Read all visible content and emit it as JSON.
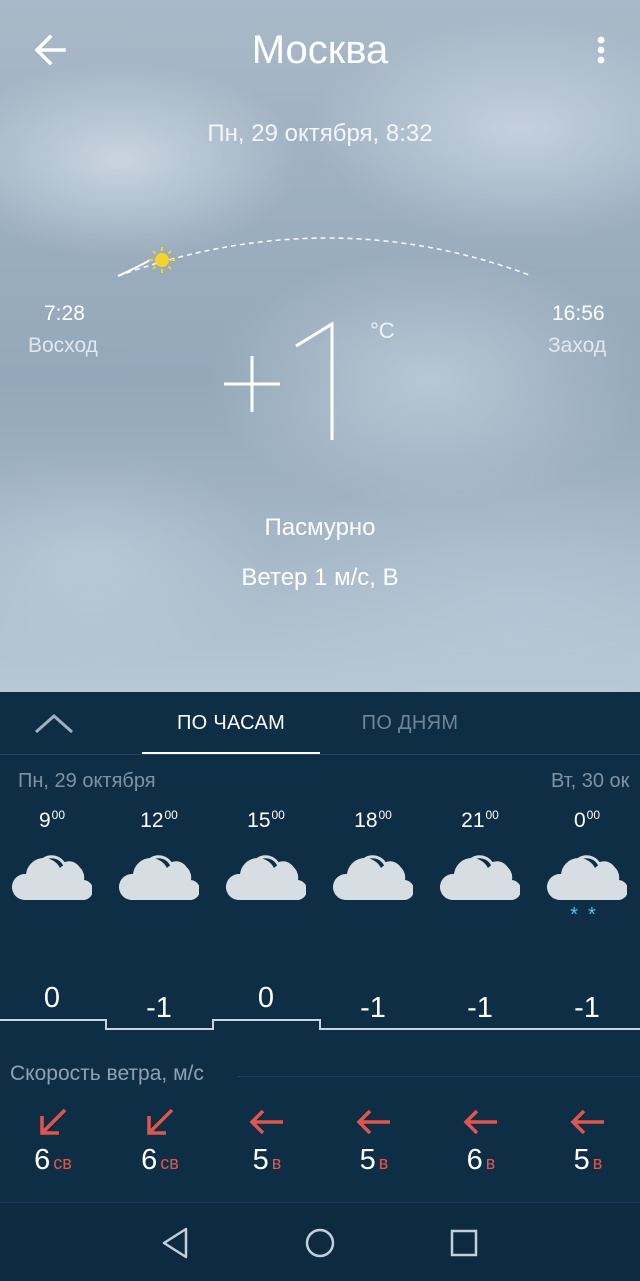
{
  "header": {
    "city": "Москва",
    "back_icon": "arrow-left-icon",
    "menu_icon": "more-vertical-icon"
  },
  "current": {
    "datetime": "Пн, 29 октября, 8:32",
    "temperature": "+1",
    "unit": "°C",
    "condition": "Пасмурно",
    "wind": "Ветер 1 м/с, В"
  },
  "sun": {
    "sunrise_time": "7:28",
    "sunrise_label": "Восход",
    "sunset_time": "16:56",
    "sunset_label": "Заход"
  },
  "tabs": {
    "hours": "ПО ЧАСАМ",
    "days": "ПО ДНЯМ",
    "active": "hours"
  },
  "forecast": {
    "day1": "Пн, 29 октября",
    "day2": "Вт, 30 ок",
    "hours": [
      {
        "hour": "9",
        "min": "00",
        "temp": "0",
        "wind_speed": "6",
        "wind_dir": "св",
        "icon": "cloudy-icon"
      },
      {
        "hour": "12",
        "min": "00",
        "temp": "-1",
        "wind_speed": "6",
        "wind_dir": "св",
        "icon": "cloudy-icon"
      },
      {
        "hour": "15",
        "min": "00",
        "temp": "0",
        "wind_speed": "5",
        "wind_dir": "в",
        "icon": "cloudy-icon"
      },
      {
        "hour": "18",
        "min": "00",
        "temp": "-1",
        "wind_speed": "5",
        "wind_dir": "в",
        "icon": "cloudy-icon"
      },
      {
        "hour": "21",
        "min": "00",
        "temp": "-1",
        "wind_speed": "6",
        "wind_dir": "в",
        "icon": "cloudy-icon"
      },
      {
        "hour": "0",
        "min": "00",
        "temp": "-1",
        "wind_speed": "5",
        "wind_dir": "в",
        "icon": "cloudy-snow-icon"
      }
    ],
    "wind_title": "Скорость ветра, м/с"
  },
  "colors": {
    "panel": "#0d2e45",
    "wind_arrow": "#e0554f",
    "snow": "#4fc3f7"
  }
}
